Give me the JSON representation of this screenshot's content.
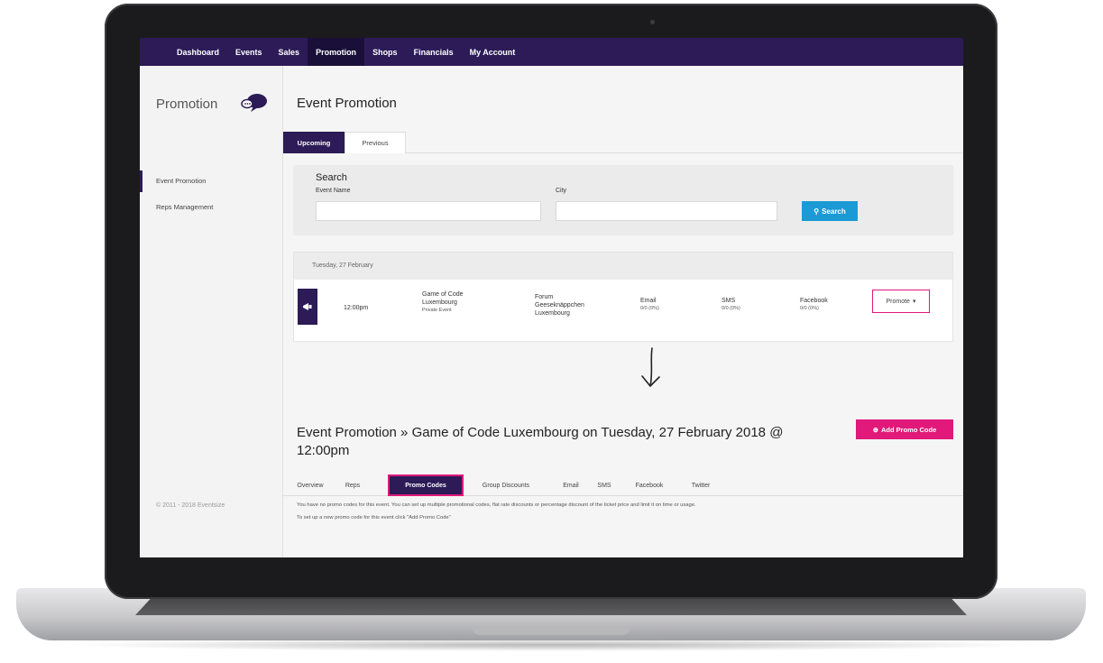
{
  "topnav": {
    "items": [
      "Dashboard",
      "Events",
      "Sales",
      "Promotion",
      "Shops",
      "Financials",
      "My Account"
    ],
    "active": "Promotion"
  },
  "sidebar": {
    "title": "Promotion",
    "items": [
      {
        "label": "Event Promotion",
        "active": true
      },
      {
        "label": "Reps Management",
        "active": false
      }
    ],
    "footer": "© 2011 - 2018 Eventsize"
  },
  "main": {
    "title": "Event Promotion",
    "tabs": [
      {
        "label": "Upcoming",
        "active": true
      },
      {
        "label": "Previous",
        "active": false
      }
    ]
  },
  "search": {
    "heading": "Search",
    "event_name_label": "Event Name",
    "event_name_value": "",
    "city_label": "City",
    "city_value": "",
    "button_label": "Search"
  },
  "event": {
    "date_header": "Tuesday, 27 February",
    "time": "12:00pm",
    "name_line1": "Game of Code",
    "name_line2": "Luxembourg",
    "visibility": "Private Event",
    "venue_line1": "Forum",
    "venue_line2": "Geeseknäppchen",
    "venue_line3": "Luxembourg",
    "email_label": "Email",
    "email_stat": "0/0 (0%)",
    "sms_label": "SMS",
    "sms_stat": "0/0 (0%)",
    "facebook_label": "Facebook",
    "facebook_stat": "0/0 (0%)",
    "promote_label": "Promote"
  },
  "detail": {
    "title": "Event Promotion » Game of Code Luxembourg on Tuesday, 27 February 2018 @ 12:00pm",
    "add_button_label": "Add Promo Code",
    "tabs": [
      {
        "label": "Overview",
        "active": false
      },
      {
        "label": "Reps",
        "active": false
      },
      {
        "label": "Promo Codes",
        "active": true
      },
      {
        "label": "Group Discounts",
        "active": false
      },
      {
        "label": "Email",
        "active": false
      },
      {
        "label": "SMS",
        "active": false
      },
      {
        "label": "Facebook",
        "active": false
      },
      {
        "label": "Twitter",
        "active": false
      }
    ],
    "info_line1": "You have no promo codes for this event. You can set up multiple promotional codes, flat rate discounts or percentage discount of the ticket price and limit it on time or usage.",
    "info_line2": "To set up a new promo code for this event click \"Add Promo Code\""
  },
  "colors": {
    "nav_bg": "#2c1b57",
    "accent_pink": "#e0197a",
    "search_blue": "#1b9ad6"
  }
}
